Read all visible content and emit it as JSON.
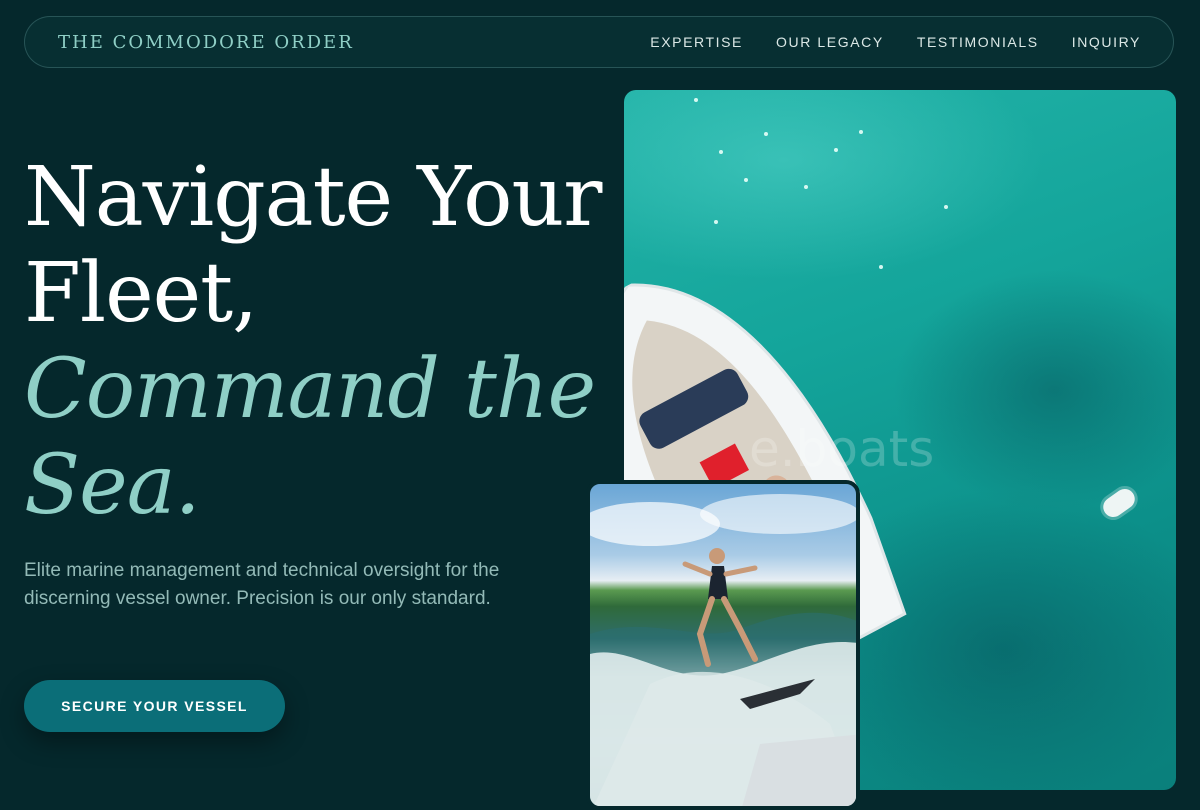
{
  "brand": "THE COMMODORE ORDER",
  "nav": {
    "items": [
      {
        "label": "EXPERTISE"
      },
      {
        "label": "OUR LEGACY"
      },
      {
        "label": "TESTIMONIALS"
      },
      {
        "label": "INQUIRY"
      }
    ]
  },
  "hero": {
    "line1": "Navigate Your",
    "line2": "Fleet,",
    "line3": "Command the",
    "line4": "Sea.",
    "lede": "Elite marine management and technical oversight for the discerning vessel owner. Precision is our only standard.",
    "cta_label": "SECURE YOUR VESSEL"
  },
  "images": {
    "aerial_watermark": "e.boats",
    "aerial_description_icon": "aerial-boat-image",
    "inset_description_icon": "wakesurf-image"
  },
  "colors": {
    "background": "#05282c",
    "accent": "#8fcfc6",
    "cta": "#0b6e78",
    "text": "#ffffff"
  }
}
